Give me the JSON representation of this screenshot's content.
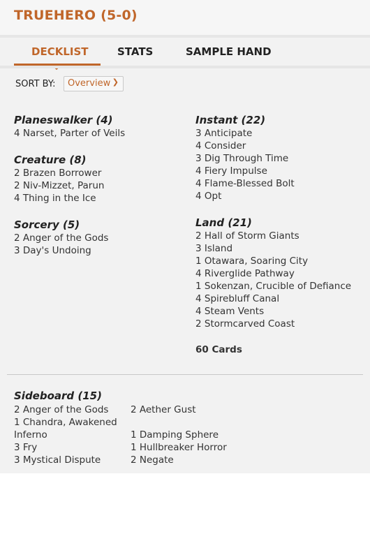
{
  "header": {
    "title": "TRUEHERO (5-0)"
  },
  "tabs": [
    {
      "label": "DECKLIST",
      "active": true
    },
    {
      "label": "STATS",
      "active": false
    },
    {
      "label": "SAMPLE HAND",
      "active": false
    }
  ],
  "sort": {
    "label": "SORT BY:",
    "value": "Overview"
  },
  "left_column": [
    {
      "title": "Planeswalker (4)",
      "items": [
        "4 Narset, Parter of Veils"
      ]
    },
    {
      "title": "Creature (8)",
      "items": [
        "2 Brazen Borrower",
        "2 Niv-Mizzet, Parun",
        "4 Thing in the Ice"
      ]
    },
    {
      "title": "Sorcery (5)",
      "items": [
        "2 Anger of the Gods",
        "3 Day's Undoing"
      ]
    }
  ],
  "right_column": [
    {
      "title": "Instant (22)",
      "items": [
        "3 Anticipate",
        "4 Consider",
        "3 Dig Through Time",
        "4 Fiery Impulse",
        "4 Flame-Blessed Bolt",
        "4 Opt"
      ]
    },
    {
      "title": "Land (21)",
      "items": [
        "2 Hall of Storm Giants",
        "3 Island",
        "1 Otawara, Soaring City",
        "4 Riverglide Pathway",
        "1 Sokenzan, Crucible of Defiance",
        "4 Spirebluff Canal",
        "4 Steam Vents",
        "2 Stormcarved Coast"
      ]
    }
  ],
  "total": "60 Cards",
  "sideboard": {
    "title": "Sideboard (15)",
    "col1": [
      "2 Anger of the Gods",
      "1 Chandra, Awakened Inferno",
      "3 Fry",
      "3 Mystical Dispute"
    ],
    "col2": [
      "2 Aether Gust",
      "1 Damping Sphere",
      "1 Hullbreaker Horror",
      "2 Negate"
    ]
  },
  "colors": {
    "accent": "#c0662a",
    "panel": "#f2f2f2"
  }
}
